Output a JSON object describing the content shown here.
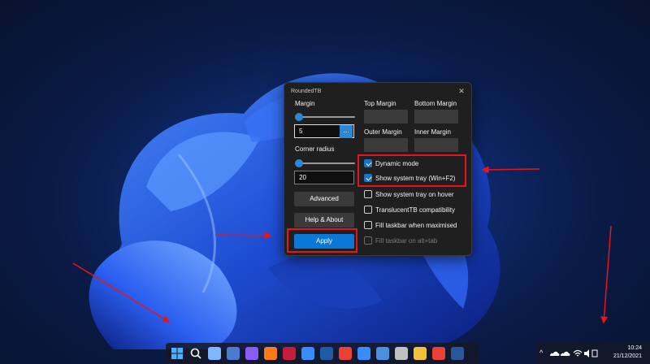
{
  "dialog": {
    "title": "RoundedTB",
    "close_glyph": "✕",
    "margin_label": "Margin",
    "margin_value": "5",
    "margin_slider_fraction": 0.0,
    "dots_button_label": "...",
    "corner_radius_label": "Corner radius",
    "corner_radius_value": "20",
    "corner_slider_fraction": 0.0,
    "top_margin_label": "Top Margin",
    "bottom_margin_label": "Bottom Margin",
    "outer_margin_label": "Outer Margin",
    "inner_margin_label": "Inner Margin",
    "advanced_label": "Advanced",
    "help_about_label": "Help & About",
    "apply_label": "Apply",
    "options": [
      {
        "label": "Dynamic mode",
        "checked": true,
        "enabled": true
      },
      {
        "label": "Show system tray (Win+F2)",
        "checked": true,
        "enabled": true
      },
      {
        "label": "Show system tray on hover",
        "checked": false,
        "enabled": true
      },
      {
        "label": "TranslucentTB compatibility",
        "checked": false,
        "enabled": true
      },
      {
        "label": "Fill taskbar when maximised",
        "checked": false,
        "enabled": true
      },
      {
        "label": "Fill taskbar on alt+tab",
        "checked": false,
        "enabled": false
      }
    ],
    "accent_color": "#0a78d7"
  },
  "annotation": {
    "highlight_color": "#e8141c"
  },
  "taskbar": {
    "icons": [
      "windows-start-icon",
      "search-icon",
      "task-view-icon",
      "widgets-icon",
      "chat-icon",
      "firefox-icon",
      "app-icon",
      "onedrive-icon",
      "app-r-icon",
      "chrome-icon",
      "notepad-icon",
      "mail-icon",
      "settings-icon",
      "file-explorer-icon",
      "chrome-alt-icon",
      "word-icon"
    ],
    "tray": {
      "chevron": "^",
      "time": "10:24",
      "date": "21/12/2021"
    }
  }
}
